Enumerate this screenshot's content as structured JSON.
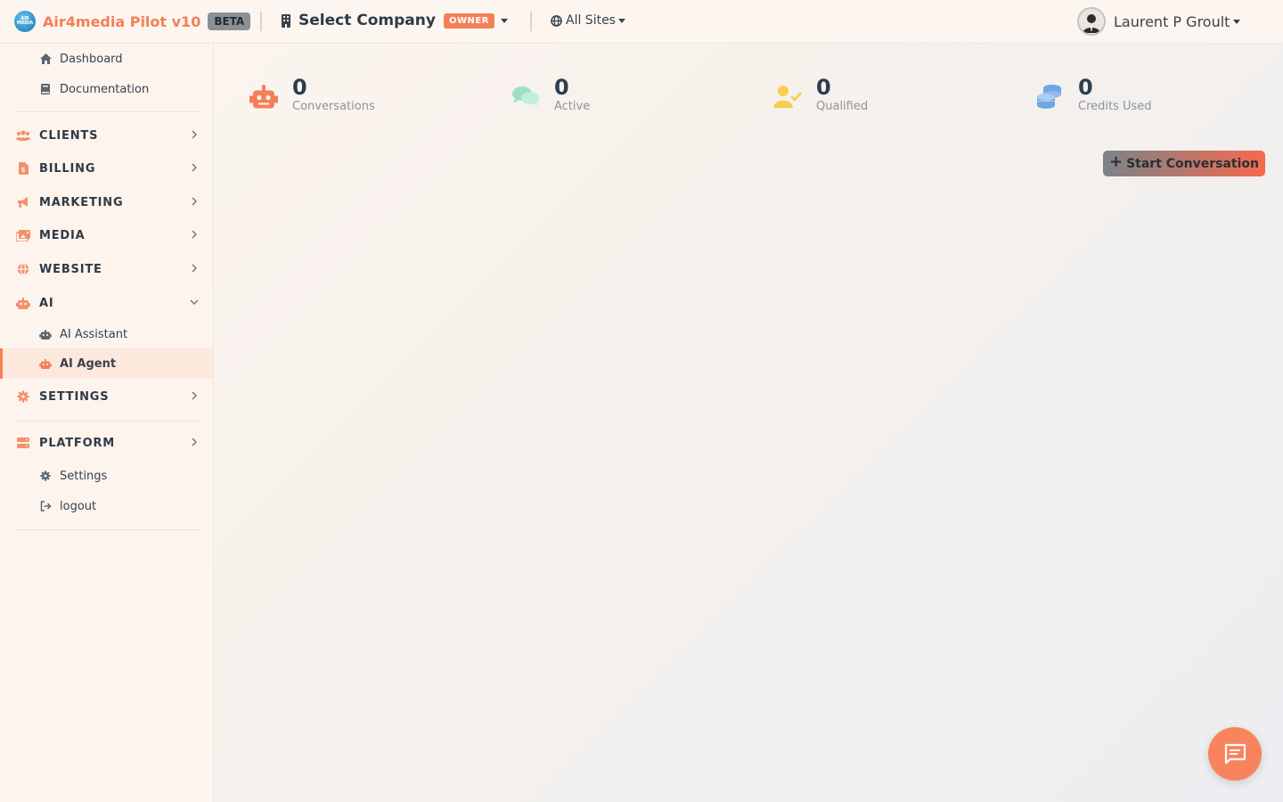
{
  "header": {
    "logo_text": "AIR MEDIA",
    "brand": "Air4media Pilot v10",
    "beta_badge": "BETA",
    "company_label": "Select Company",
    "owner_badge": "OWNER",
    "sites_label": "All Sites",
    "user_name": "Laurent P Groult"
  },
  "sidebar": {
    "top_links": [
      {
        "label": "Dashboard",
        "icon": "home-icon"
      },
      {
        "label": "Documentation",
        "icon": "book-icon"
      }
    ],
    "sections": [
      {
        "label": "CLIENTS",
        "icon": "users-icon"
      },
      {
        "label": "BILLING",
        "icon": "invoice-icon"
      },
      {
        "label": "MARKETING",
        "icon": "megaphone-icon"
      },
      {
        "label": "MEDIA",
        "icon": "images-icon"
      },
      {
        "label": "WEBSITE",
        "icon": "globe-icon"
      },
      {
        "label": "AI",
        "icon": "robot-icon",
        "expanded": true
      }
    ],
    "ai_items": [
      {
        "label": "AI Assistant",
        "icon": "robot-icon"
      },
      {
        "label": "AI Agent",
        "icon": "robot-icon",
        "active": true
      }
    ],
    "settings_section": {
      "label": "SETTINGS",
      "icon": "gear-icon"
    },
    "platform_section": {
      "label": "PLATFORM",
      "icon": "server-icon"
    },
    "bottom_links": [
      {
        "label": "Settings",
        "icon": "gear-icon"
      },
      {
        "label": "logout",
        "icon": "logout-icon"
      }
    ]
  },
  "stats": [
    {
      "value": "0",
      "label": "Conversations",
      "icon": "robot-icon",
      "color": "#f47f57"
    },
    {
      "value": "0",
      "label": "Active",
      "icon": "comments-icon",
      "color": "#9ee0c6"
    },
    {
      "value": "0",
      "label": "Qualified",
      "icon": "user-check-icon",
      "color": "#f7cf4a"
    },
    {
      "value": "0",
      "label": "Credits Used",
      "icon": "coins-icon",
      "color": "#6fa6e4"
    }
  ],
  "actions": {
    "start_conversation": "Start Conversation",
    "plus": "+"
  },
  "colors": {
    "accent": "#f47f57",
    "sidebar_active_bg": "#fde8dd"
  }
}
